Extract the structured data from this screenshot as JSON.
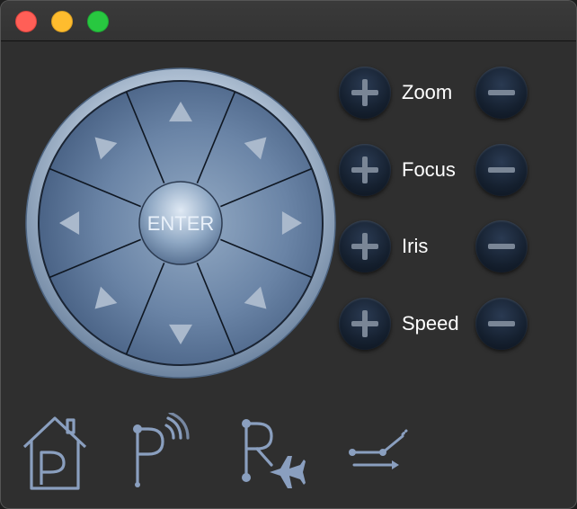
{
  "window": {
    "traffic_lights": [
      "close",
      "minimize",
      "maximize"
    ]
  },
  "joystick": {
    "center_label": "ENTER",
    "directions": [
      "up",
      "up-right",
      "right",
      "down-right",
      "down",
      "down-left",
      "left",
      "up-left"
    ]
  },
  "controls": [
    {
      "label": "Zoom"
    },
    {
      "label": "Focus"
    },
    {
      "label": "Iris"
    },
    {
      "label": "Speed"
    }
  ],
  "bottom_icons": [
    "home-preset-icon",
    "preset-signal-icon",
    "preset-travel-icon",
    "switch-icon"
  ],
  "colors": {
    "window_bg": "#2f2f2f",
    "titlebar_bg": "#363636",
    "button_dark": "#15202f",
    "icon_blue": "#8a9fbf",
    "label_text": "#ffffff"
  }
}
